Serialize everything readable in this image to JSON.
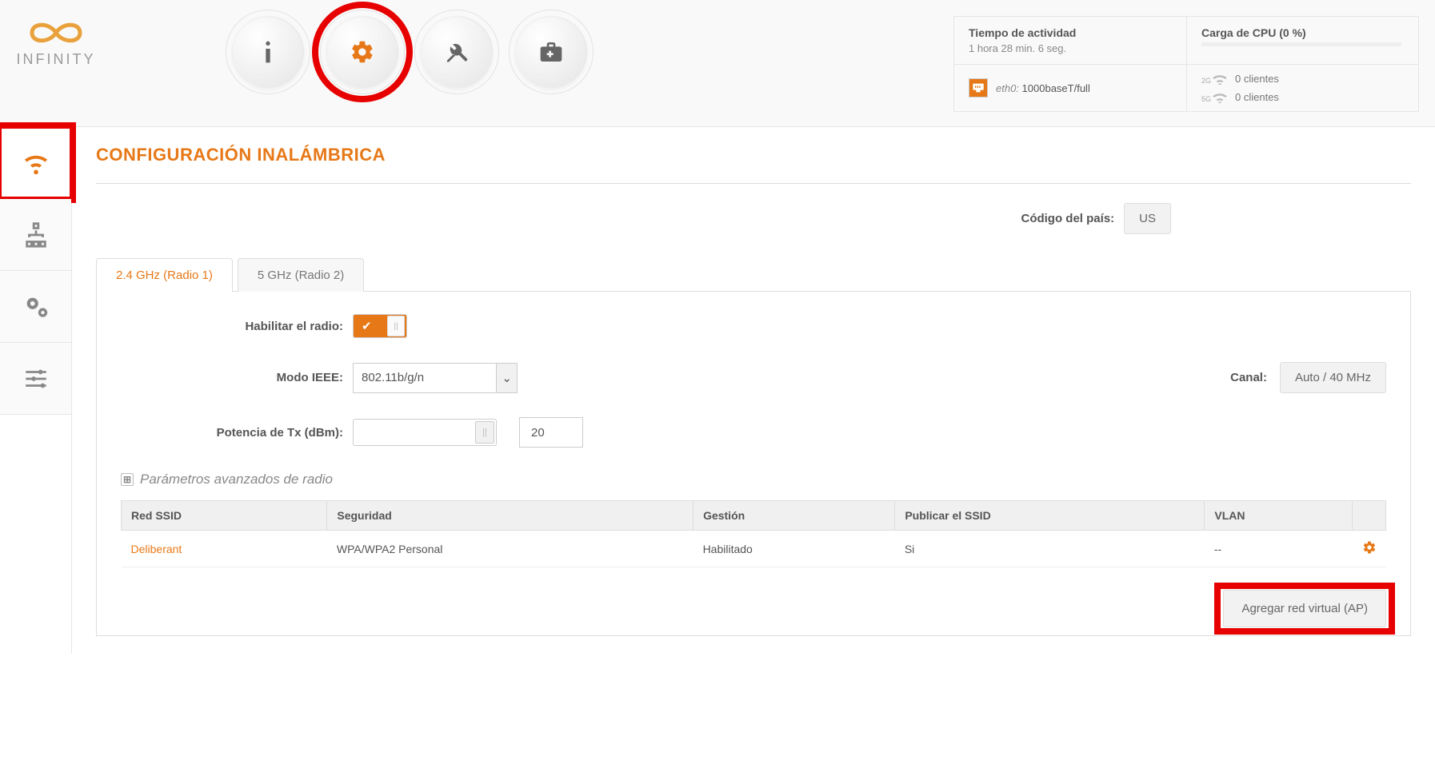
{
  "brand": "INFINITY",
  "header": {
    "uptime_label": "Tiempo de actividad",
    "uptime_value": "1 hora 28 min. 6 seg.",
    "cpu_label": "Carga de CPU (0 %)",
    "eth_interface": "eth0:",
    "eth_speed": "1000baseT/full",
    "clients_2g_band": "2G",
    "clients_2g_text": "0 clientes",
    "clients_5g_band": "5G",
    "clients_5g_text": "0 clientes"
  },
  "page_title": "CONFIGURACIÓN INALÁMBRICA",
  "country": {
    "label": "Código del país:",
    "value": "US"
  },
  "tabs": {
    "radio1": "2.4 GHz (Radio 1)",
    "radio2": "5 GHz (Radio 2)"
  },
  "form": {
    "enable_radio": "Habilitar el radio:",
    "ieee_mode": "Modo IEEE:",
    "ieee_value": "802.11b/g/n",
    "channel_label": "Canal:",
    "channel_value": "Auto / 40 MHz",
    "tx_power": "Potencia de Tx (dBm):",
    "tx_power_value": "20",
    "advanced": "Parámetros avanzados de radio"
  },
  "table": {
    "headers": {
      "ssid": "Red SSID",
      "security": "Seguridad",
      "mgmt": "Gestión",
      "publish": "Publicar el SSID",
      "vlan": "VLAN"
    },
    "row": {
      "ssid": "Deliberant",
      "security": "WPA/WPA2 Personal",
      "mgmt": "Habilitado",
      "publish": "Si",
      "vlan": "--"
    }
  },
  "actions": {
    "add_vap": "Agregar red virtual (AP)"
  }
}
